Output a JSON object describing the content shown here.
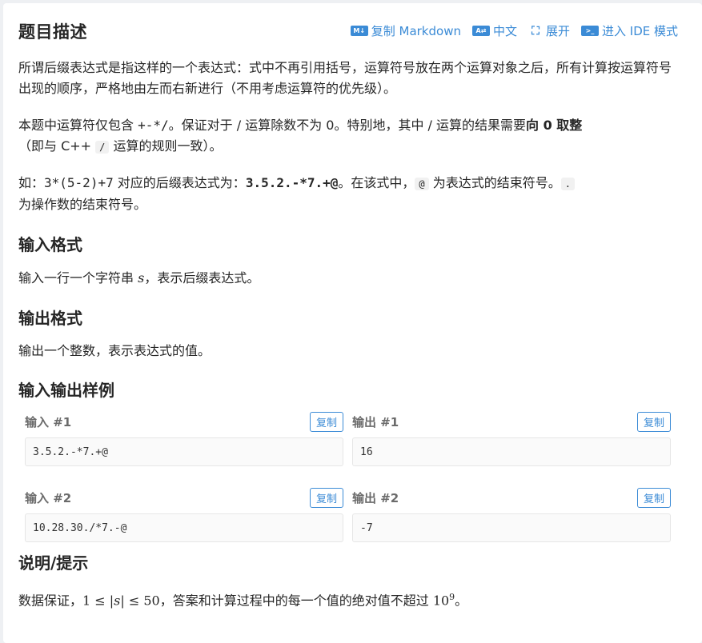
{
  "header": {
    "title": "题目描述",
    "actions": [
      {
        "icon": "M↓",
        "label": "复制 Markdown"
      },
      {
        "icon": "A⇄",
        "label": "中文"
      },
      {
        "icon": "⛶",
        "label": "展开"
      },
      {
        "icon": ">_",
        "label": "进入 IDE 模式"
      }
    ]
  },
  "description": {
    "p1": "所谓后缀表达式是指这样的一个表达式：式中不再引用括号，运算符号放在两个运算对象之后，所有计算按运算符号出现的顺序，严格地由左而右新进行（不用考虑运算符的优先级）。",
    "p2_a": "本题中运算符仅包含 ",
    "p2_ops": "+-*/",
    "p2_b": "。保证对于 / 运算除数不为 0。特别地，其中 / 运算的结果需要",
    "p2_bold": "向 0 取整",
    "p2_c": "（即与 C++ ",
    "p2_code": "/",
    "p2_d": " 运算的规则一致）。",
    "p3_a": "如：",
    "p3_expr": "3*(5-2)+7",
    "p3_b": " 对应的后缀表达式为：",
    "p3_post": "3.5.2.-*7.+@",
    "p3_c": "。在该式中，",
    "p3_at": "@",
    "p3_d": " 为表达式的结束符号。",
    "p3_dot": ".",
    "p3_e": "为操作数的结束符号。"
  },
  "input_format": {
    "heading": "输入格式",
    "text_a": "输入一行一个字符串 ",
    "var": "s",
    "text_b": "，表示后缀表达式。"
  },
  "output_format": {
    "heading": "输出格式",
    "text": "输出一个整数，表示表达式的值。"
  },
  "samples": {
    "heading": "输入输出样例",
    "copy_label": "复制",
    "items": [
      {
        "in_label": "输入 #1",
        "in": "3.5.2.-*7.+@",
        "out_label": "输出 #1",
        "out": "16"
      },
      {
        "in_label": "输入 #2",
        "in": "10.28.30./*7.-@",
        "out_label": "输出 #2",
        "out": "-7"
      }
    ]
  },
  "hint": {
    "heading": "说明/提示",
    "text_a": "数据保证，",
    "math_lo": "1",
    "math_le1": " ≤ ",
    "math_var": "|s|",
    "math_le2": " ≤ ",
    "math_hi": "50",
    "text_b": "，答案和计算过程中的每一个值的绝对值不超过 ",
    "pow_base": "10",
    "pow_exp": "9",
    "text_c": "。"
  },
  "colors": {
    "accent": "#3b8bd6",
    "background": "#eef0f3",
    "card": "#ffffff"
  }
}
